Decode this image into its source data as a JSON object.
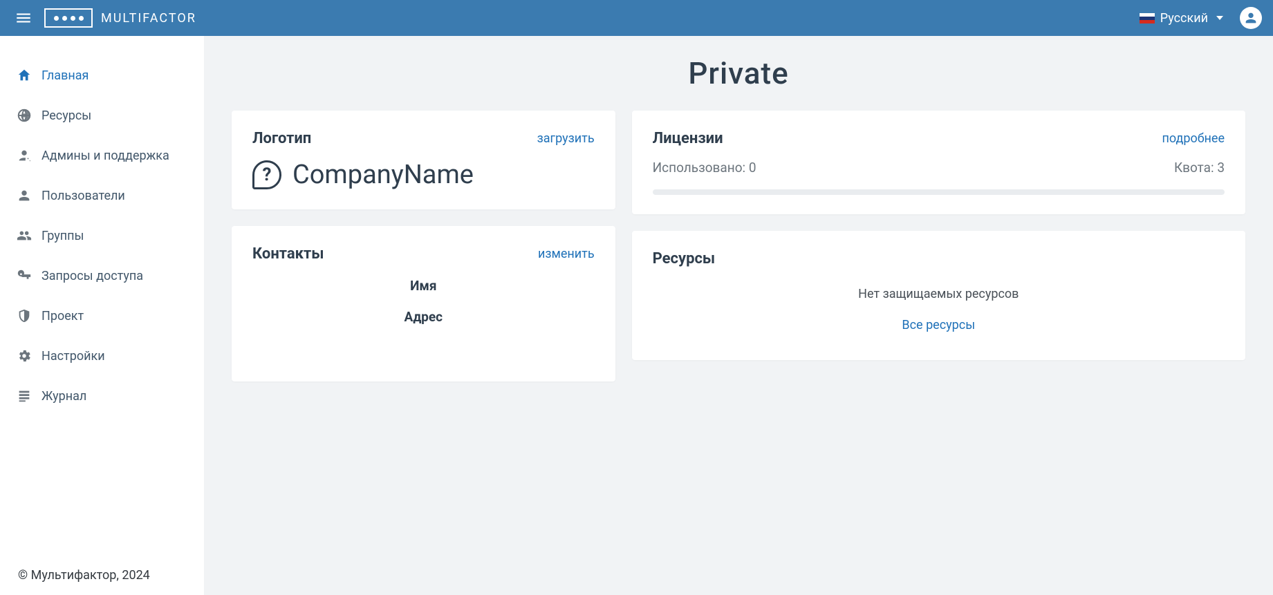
{
  "header": {
    "brand": "MULTIFACTOR",
    "language_label": "Русский"
  },
  "sidebar": {
    "items": [
      {
        "label": "Главная"
      },
      {
        "label": "Ресурсы"
      },
      {
        "label": "Админы и поддержка"
      },
      {
        "label": "Пользователи"
      },
      {
        "label": "Группы"
      },
      {
        "label": "Запросы доступа"
      },
      {
        "label": "Проект"
      },
      {
        "label": "Настройки"
      },
      {
        "label": "Журнал"
      }
    ]
  },
  "page": {
    "title": "Private"
  },
  "logo_card": {
    "title": "Логотип",
    "action": "загрузить",
    "company": "CompanyName"
  },
  "licenses_card": {
    "title": "Лицензии",
    "action": "подробнее",
    "used_label": "Использовано: 0",
    "quota_label": "Квота: 3"
  },
  "contacts_card": {
    "title": "Контакты",
    "action": "изменить",
    "name_label": "Имя",
    "address_label": "Адрес"
  },
  "resources_card": {
    "title": "Ресурсы",
    "empty_text": "Нет защищаемых ресурсов",
    "all_link": "Все ресурсы"
  },
  "footer": "© Мультифактор, 2024"
}
